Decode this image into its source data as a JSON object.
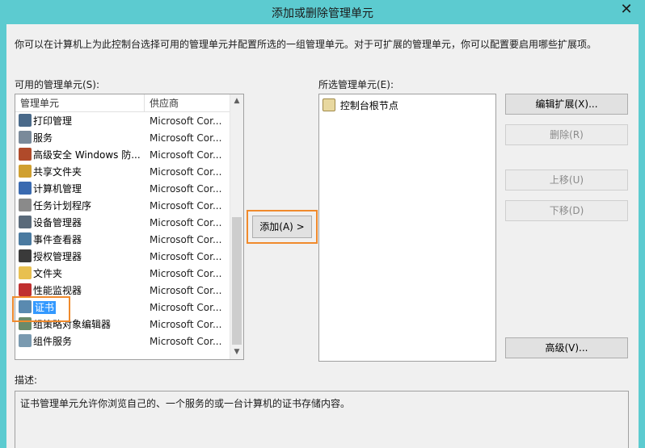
{
  "window": {
    "title": "添加或删除管理单元",
    "close_glyph": "✕"
  },
  "intro_text": "你可以在计算机上为此控制台选择可用的管理单元并配置所选的一组管理单元。对于可扩展的管理单元，你可以配置要启用哪些扩展项。",
  "available": {
    "label": "可用的管理单元(S):",
    "columns": [
      "管理单元",
      "供应商"
    ],
    "items": [
      {
        "name": "打印管理",
        "vendor": "Microsoft Cor...",
        "icon": "printer-icon",
        "color": "#4a6a8a"
      },
      {
        "name": "服务",
        "vendor": "Microsoft Cor...",
        "icon": "gears-icon",
        "color": "#7a8a9a"
      },
      {
        "name": "高级安全 Windows 防...",
        "vendor": "Microsoft Cor...",
        "icon": "firewall-icon",
        "color": "#b04a2a"
      },
      {
        "name": "共享文件夹",
        "vendor": "Microsoft Cor...",
        "icon": "shared-folder-icon",
        "color": "#d0a030"
      },
      {
        "name": "计算机管理",
        "vendor": "Microsoft Cor...",
        "icon": "computer-management-icon",
        "color": "#3a6ab0"
      },
      {
        "name": "任务计划程序",
        "vendor": "Microsoft Cor...",
        "icon": "clock-icon",
        "color": "#8a8a8a"
      },
      {
        "name": "设备管理器",
        "vendor": "Microsoft Cor...",
        "icon": "device-manager-icon",
        "color": "#5a6a7a"
      },
      {
        "name": "事件查看器",
        "vendor": "Microsoft Cor...",
        "icon": "event-viewer-icon",
        "color": "#4a7aa0"
      },
      {
        "name": "授权管理器",
        "vendor": "Microsoft Cor...",
        "icon": "authorization-icon",
        "color": "#3a3a3a"
      },
      {
        "name": "文件夹",
        "vendor": "Microsoft Cor...",
        "icon": "folder-icon",
        "color": "#e8c050"
      },
      {
        "name": "性能监视器",
        "vendor": "Microsoft Cor...",
        "icon": "performance-icon",
        "color": "#c03030"
      },
      {
        "name": "证书",
        "vendor": "Microsoft Cor...",
        "icon": "certificate-icon",
        "color": "#5a8ab0",
        "selected": true
      },
      {
        "name": "组策略对象编辑器",
        "vendor": "Microsoft Cor...",
        "icon": "group-policy-icon",
        "color": "#6a8a6a"
      },
      {
        "name": "组件服务",
        "vendor": "Microsoft Cor...",
        "icon": "component-services-icon",
        "color": "#7a9ab0"
      }
    ]
  },
  "add_button": "添加(A) >",
  "selected": {
    "label": "所选管理单元(E):",
    "root_node": "控制台根节点"
  },
  "buttons": {
    "edit_extensions": "编辑扩展(X)...",
    "remove": "删除(R)",
    "move_up": "上移(U)",
    "move_down": "下移(D)",
    "advanced": "高级(V)..."
  },
  "description": {
    "label": "描述:",
    "text": "证书管理单元允许你浏览自己的、一个服务的或一台计算机的证书存储内容。"
  },
  "colors": {
    "titlebar": "#5ccbd0",
    "highlight": "#f08a2c",
    "selection": "#3399ff"
  }
}
